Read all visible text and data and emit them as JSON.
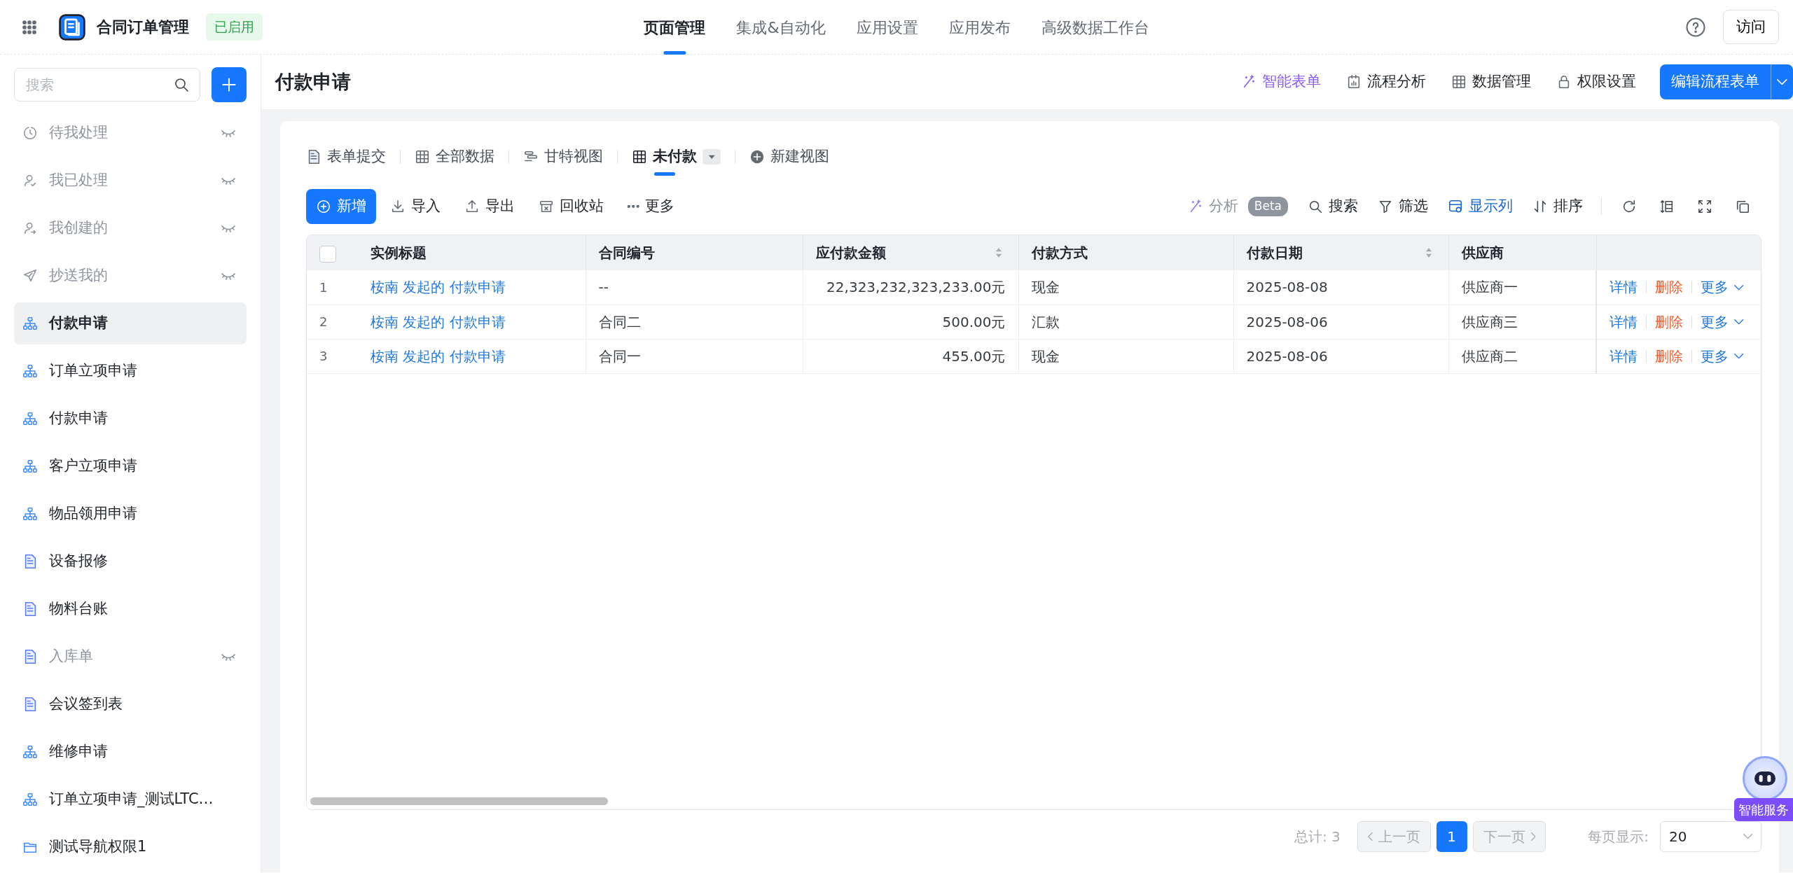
{
  "app": {
    "title": "合同订单管理",
    "status": "已启用"
  },
  "top_nav": [
    {
      "label": "页面管理",
      "selected": true
    },
    {
      "label": "集成&自动化",
      "selected": false
    },
    {
      "label": "应用设置",
      "selected": false
    },
    {
      "label": "应用发布",
      "selected": false
    },
    {
      "label": "高级数据工作台",
      "selected": false
    }
  ],
  "visit_button": "访问",
  "sidebar": {
    "search_placeholder": "搜索",
    "items": [
      {
        "label": "待我处理",
        "kind": "clock",
        "hidden": true,
        "selected": false
      },
      {
        "label": "我已处理",
        "kind": "user-check",
        "hidden": true,
        "selected": false
      },
      {
        "label": "我创建的",
        "kind": "user-arrow",
        "hidden": true,
        "selected": false
      },
      {
        "label": "抄送我的",
        "kind": "send",
        "hidden": true,
        "selected": false
      },
      {
        "label": "付款申请",
        "kind": "flow",
        "hidden": false,
        "selected": true
      },
      {
        "label": "订单立项申请",
        "kind": "flow",
        "hidden": false,
        "selected": false
      },
      {
        "label": "付款申请",
        "kind": "flow",
        "hidden": false,
        "selected": false
      },
      {
        "label": "客户立项申请",
        "kind": "flow",
        "hidden": false,
        "selected": false
      },
      {
        "label": "物品领用申请",
        "kind": "flow",
        "hidden": false,
        "selected": false
      },
      {
        "label": "设备报修",
        "kind": "form",
        "hidden": false,
        "selected": false
      },
      {
        "label": "物料台账",
        "kind": "form",
        "hidden": false,
        "selected": false
      },
      {
        "label": "入库单",
        "kind": "form",
        "hidden": true,
        "selected": false
      },
      {
        "label": "会议签到表",
        "kind": "form",
        "hidden": false,
        "selected": false
      },
      {
        "label": "维修申请",
        "kind": "flow",
        "hidden": false,
        "selected": false
      },
      {
        "label": "订单立项申请_测试LTC…",
        "kind": "flow",
        "hidden": false,
        "selected": false
      },
      {
        "label": "测试导航权限1",
        "kind": "folder",
        "hidden": false,
        "selected": false
      }
    ]
  },
  "page": {
    "title": "付款申请",
    "actions": [
      {
        "label": "智能表单",
        "kind": "ai"
      },
      {
        "label": "流程分析",
        "kind": "analysis"
      },
      {
        "label": "数据管理",
        "kind": "grid"
      },
      {
        "label": "权限设置",
        "kind": "lock"
      }
    ],
    "primary_button": "编辑流程表单"
  },
  "views": [
    {
      "label": "表单提交",
      "kind": "form",
      "selected": false
    },
    {
      "label": "全部数据",
      "kind": "table",
      "selected": false
    },
    {
      "label": "甘特视图",
      "kind": "gantt",
      "selected": false
    },
    {
      "label": "未付款",
      "kind": "table",
      "selected": true
    }
  ],
  "new_view": "新建视图",
  "toolbar_left": [
    {
      "label": "新增",
      "kind": "add"
    },
    {
      "label": "导入",
      "kind": "import"
    },
    {
      "label": "导出",
      "kind": "export"
    },
    {
      "label": "回收站",
      "kind": "recycle"
    },
    {
      "label": "更多",
      "kind": "more"
    }
  ],
  "toolbar_right": [
    {
      "label": "分析",
      "kind": "ai",
      "badge": "Beta",
      "active": false
    },
    {
      "label": "搜索",
      "kind": "search",
      "active": false
    },
    {
      "label": "筛选",
      "kind": "filter",
      "active": false
    },
    {
      "label": "显示列",
      "kind": "columns",
      "active": true
    },
    {
      "label": "排序",
      "kind": "sort",
      "active": false
    }
  ],
  "toolbar_icons": [
    {
      "kind": "refresh"
    },
    {
      "kind": "row-height"
    },
    {
      "kind": "fullscreen"
    },
    {
      "kind": "copy"
    }
  ],
  "table": {
    "select_all": {
      "checked": false
    },
    "columns": [
      {
        "label": "实例标题",
        "sortable": false
      },
      {
        "label": "合同编号",
        "sortable": false
      },
      {
        "label": "应付款金额",
        "sortable": true
      },
      {
        "label": "付款方式",
        "sortable": false
      },
      {
        "label": "付款日期",
        "sortable": true
      },
      {
        "label": "供应商",
        "sortable": false
      }
    ],
    "rows": [
      {
        "index": "1",
        "cells": [
          "桉南 发起的 付款申请",
          "--",
          "22,323,232,323,233.00元",
          "现金",
          "2025-08-08",
          "供应商一"
        ],
        "actions": [
          {
            "label": "详情",
            "kind": "detail"
          },
          {
            "label": "删除",
            "kind": "delete"
          },
          {
            "label": "更多",
            "kind": "more"
          }
        ]
      },
      {
        "index": "2",
        "cells": [
          "桉南 发起的 付款申请",
          "合同二",
          "500.00元",
          "汇款",
          "2025-08-06",
          "供应商三"
        ],
        "actions": [
          {
            "label": "详情",
            "kind": "detail"
          },
          {
            "label": "删除",
            "kind": "delete"
          },
          {
            "label": "更多",
            "kind": "more"
          }
        ]
      },
      {
        "index": "3",
        "cells": [
          "桉南 发起的 付款申请",
          "合同一",
          "455.00元",
          "现金",
          "2025-08-06",
          "供应商二"
        ],
        "actions": [
          {
            "label": "详情",
            "kind": "detail"
          },
          {
            "label": "删除",
            "kind": "delete"
          },
          {
            "label": "更多",
            "kind": "more"
          }
        ]
      }
    ]
  },
  "pagination": {
    "total": "总计: 3",
    "prev": "上一页",
    "pages": [
      {
        "label": "1",
        "selected": true
      }
    ],
    "next": "下一页",
    "page_size_label": "每页显示:",
    "page_size": "20"
  },
  "assistant": {
    "label": "智能服务"
  }
}
